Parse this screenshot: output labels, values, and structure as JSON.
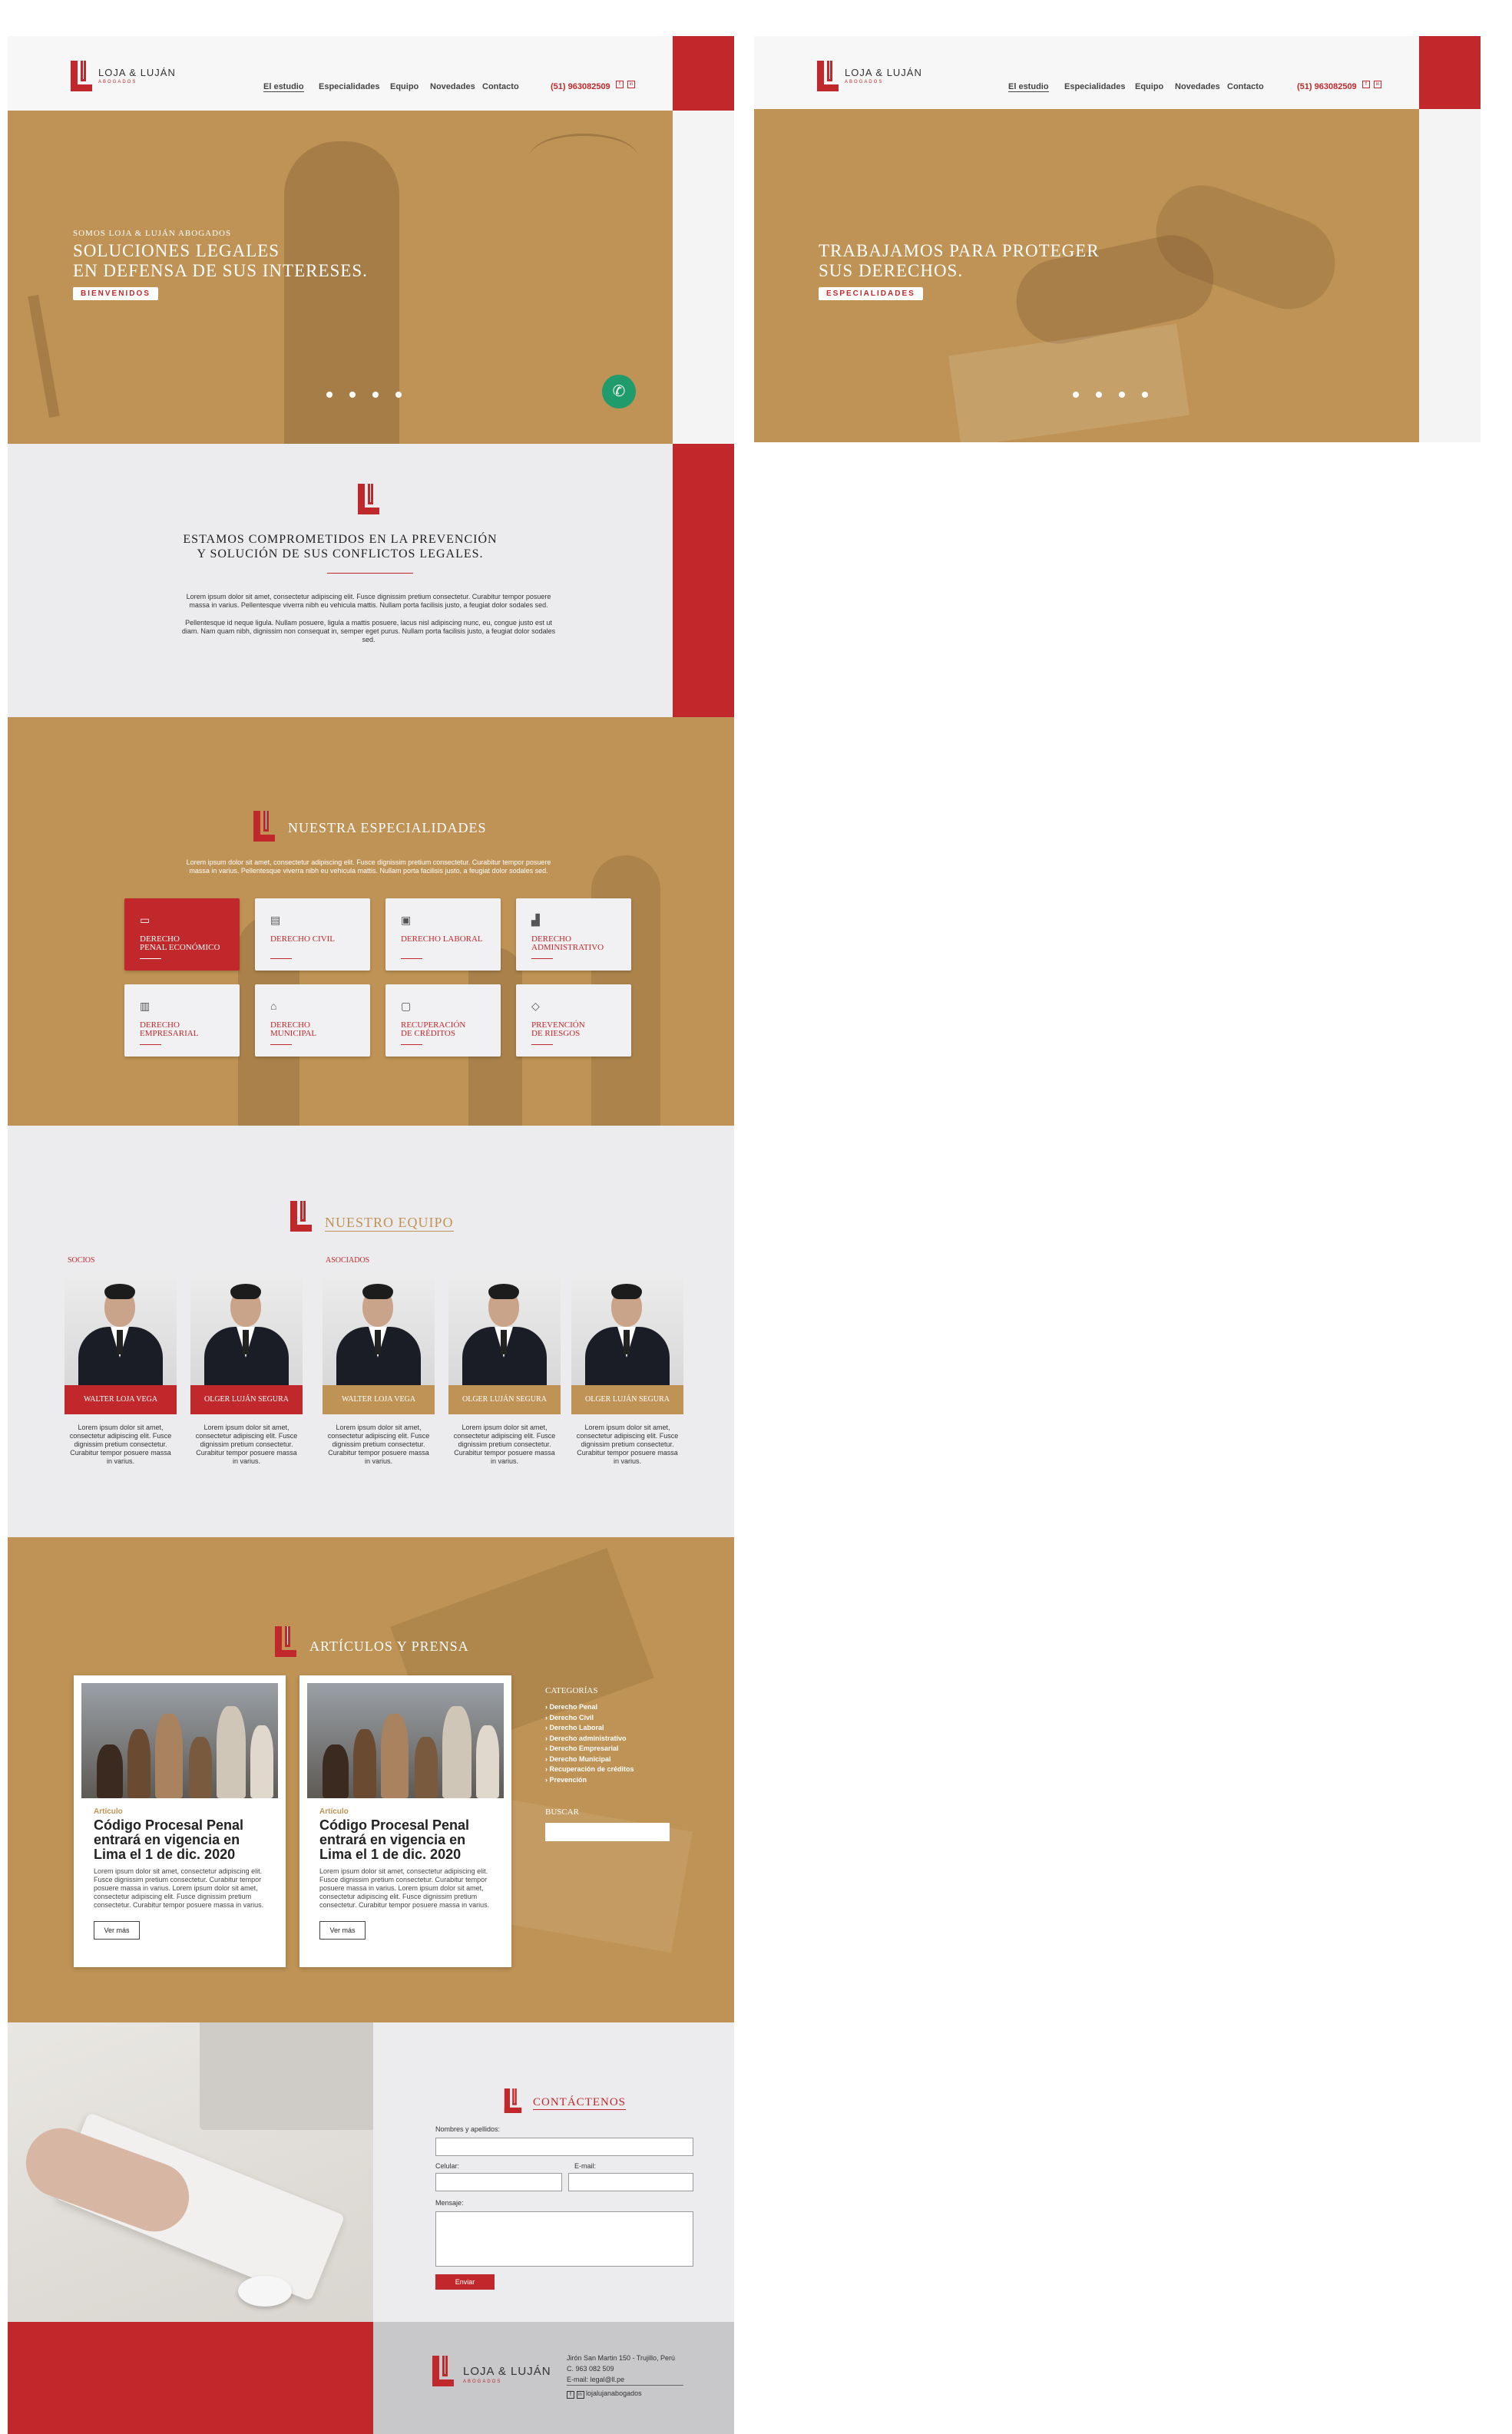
{
  "brand": {
    "name": "LOJA & LUJÁN",
    "tagline": "ABOGADOS"
  },
  "nav": {
    "items": [
      "El estudio",
      "Especialidades",
      "Equipo",
      "Novedades",
      "Contacto"
    ],
    "active": "El estudio",
    "phone": "(51) 963082509",
    "social_icons": [
      "facebook-icon",
      "linkedin-icon"
    ]
  },
  "hero1": {
    "kicker": "SOMOS LOJA & LUJÁN ABOGADOS",
    "line1": "SOLUCIONES LEGALES",
    "line2": "EN DEFENSA DE SUS INTERESES.",
    "button": "BIENVENIDOS"
  },
  "hero2": {
    "line1": "TRABAJAMOS PARA PROTEGER",
    "line2": "SUS DERECHOS.",
    "button": "ESPECIALIDADES"
  },
  "intro": {
    "line1": "ESTAMOS COMPROMETIDOS EN LA PREVENCIÓN",
    "line2": "Y SOLUCIÓN DE SUS CONFLICTOS LEGALES.",
    "p1": "Lorem ipsum dolor sit amet, consectetur adipiscing elit. Fusce dignissim pretium consectetur. Curabitur tempor posuere massa in varius. Pellentesque viverra nibh eu vehicula mattis. Nullam porta facilisis justo, a feugiat dolor sodales sed.",
    "p2": "Pellentesque id neque ligula. Nullam posuere, ligula a mattis posuere, lacus nisl adipiscing nunc, eu, congue justo est ut diam. Nam quam nibh, dignissim non consequat in, semper eget purus. Nullam porta facilisis justo, a feugiat dolor sodales sed."
  },
  "specialties": {
    "title": "NUESTRA ESPECIALIDADES",
    "text": "Lorem ipsum dolor sit amet, consectetur adipiscing elit. Fusce dignissim pretium consectetur. Curabitur tempor posuere massa in varius. Pellentesque viverra nibh eu vehicula mattis. Nullam porta facilisis justo, a feugiat dolor sodales sed.",
    "items": [
      {
        "l1": "DERECHO",
        "l2": "PENAL ECONÓMICO",
        "icon": "monitor-icon",
        "g": "▭"
      },
      {
        "l1": "DERECHO CIVIL",
        "l2": "",
        "icon": "document-icon",
        "g": "▤"
      },
      {
        "l1": "DERECHO LABORAL",
        "l2": "",
        "icon": "briefcase-icon",
        "g": "▣"
      },
      {
        "l1": "DERECHO",
        "l2": "ADMINISTRATIVO",
        "icon": "chart-icon",
        "g": "▟"
      },
      {
        "l1": "DERECHO",
        "l2": "EMPRESARIAL",
        "icon": "building-icon",
        "g": "▥"
      },
      {
        "l1": "DERECHO",
        "l2": "MUNICIPAL",
        "icon": "city-hall-icon",
        "g": "⌂"
      },
      {
        "l1": "RECUPERACIÓN",
        "l2": "DE CRÉDITOS",
        "icon": "card-icon",
        "g": "▢"
      },
      {
        "l1": "PREVENCIÓN",
        "l2": "DE RIESGOS",
        "icon": "shield-icon",
        "g": "◇"
      }
    ]
  },
  "team": {
    "title": "NUESTRO EQUIPO",
    "socios_label": "SOCIOS",
    "asociados_label": "ASOCIADOS",
    "bio": "Lorem ipsum dolor sit amet, consectetur adipiscing elit. Fusce dignissim pretium consectetur. Curabitur tempor posuere massa in varius.",
    "members": [
      "WALTER LOJA VEGA",
      "OLGER LUJÁN SEGURA",
      "WALTER LOJA VEGA",
      "OLGER LUJÁN SEGURA",
      "OLGER LUJÁN SEGURA"
    ]
  },
  "articles": {
    "title": "ARTÍCULOS Y PRENSA",
    "items": [
      {
        "tag": "Artículo",
        "title": "Código Procesal Penal entrará en vigencia en Lima el 1 de dic. 2020",
        "text": "Lorem ipsum dolor sit amet, consectetur adipiscing elit. Fusce dignissim pretium consectetur. Curabitur tempor posuere massa in varius. Lorem ipsum dolor sit amet, consectetur adipiscing elit. Fusce dignissim pretium consectetur. Curabitur tempor posuere massa in varius.",
        "button": "Ver más"
      },
      {
        "tag": "Artículo",
        "title": "Código Procesal Penal entrará en vigencia en Lima el 1 de dic. 2020",
        "text": "Lorem ipsum dolor sit amet, consectetur adipiscing elit. Fusce dignissim pretium consectetur. Curabitur tempor posuere massa in varius. Lorem ipsum dolor sit amet, consectetur adipiscing elit. Fusce dignissim pretium consectetur. Curabitur tempor posuere massa in varius.",
        "button": "Ver más"
      }
    ],
    "categories_title": "CATEGORÍAS",
    "categories": [
      "Derecho Penal",
      "Derecho Civil",
      "Derecho Laboral",
      "Derecho administrativo",
      "Derecho Empresarial",
      "Derecho Municipal",
      "Recuperación de créditos",
      "Prevención"
    ],
    "search_title": "BUSCAR"
  },
  "contact": {
    "title": "CONTÁCTENOS",
    "name_label": "Nombres y apellidos:",
    "phone_label": "Celular:",
    "email_label": "E-mail:",
    "message_label": "Mensaje:",
    "submit": "Enviar"
  },
  "footer": {
    "address": "Jirón San Martin 150 - Trujillo, Perú",
    "phone": "C. 963 082 509",
    "email": "E-mail: legal@ll.pe",
    "social": "lojalujanabogados"
  },
  "colors": {
    "red": "#c0282b",
    "gold": "#bf9355",
    "light": "#ececee"
  }
}
